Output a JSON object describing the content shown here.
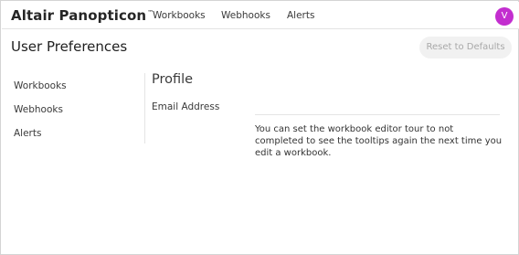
{
  "app": {
    "brand": "Altair Panopticon",
    "brand_mark": "™",
    "nav": [
      "Workbooks",
      "Webhooks",
      "Alerts"
    ],
    "user_initial": "V",
    "avatar_color": "#c32ecf"
  },
  "page": {
    "title": "User Preferences",
    "reset_button": "Reset to Defaults"
  },
  "sidebar": {
    "items": [
      "Workbooks",
      "Webhooks",
      "Alerts"
    ]
  },
  "profile": {
    "section_title": "Profile",
    "email_label": "Email Address",
    "tour_note": "You can set the workbook editor tour to not completed to see the tooltips again the next time you edit a workbook."
  }
}
